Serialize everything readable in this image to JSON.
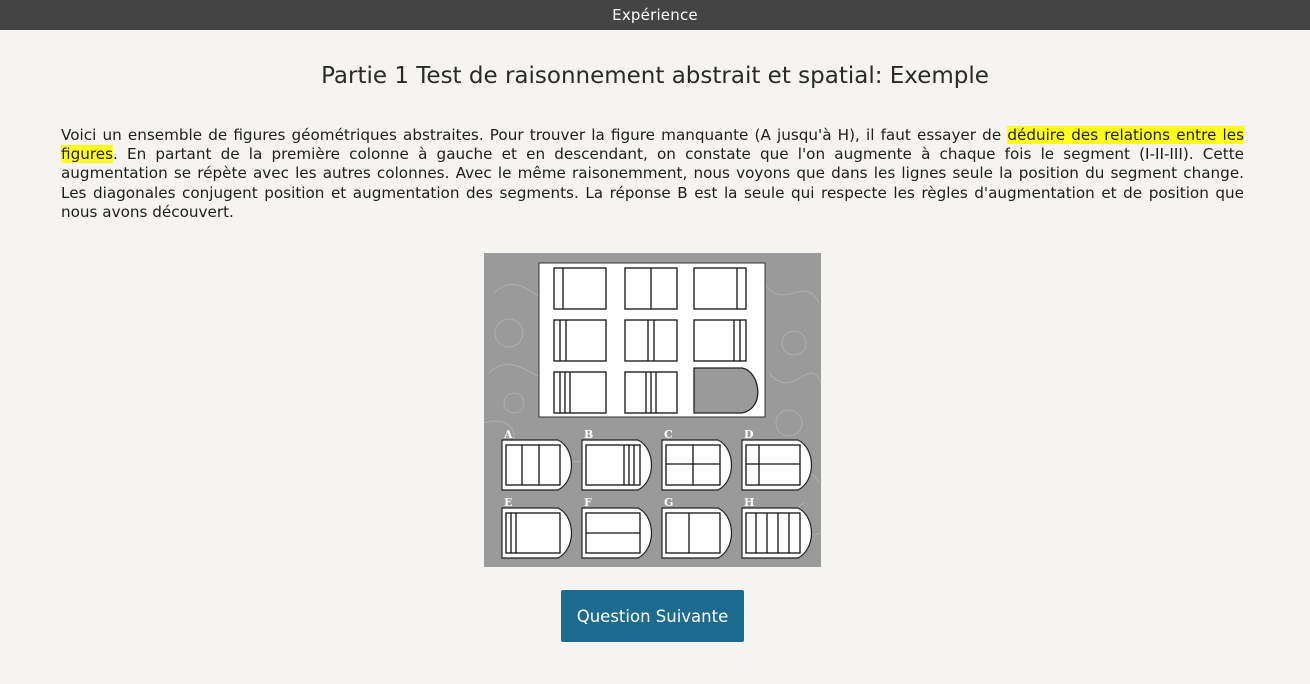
{
  "header": {
    "title": "Expérience"
  },
  "page": {
    "title": "Partie 1 Test de raisonnement abstrait et spatial: Exemple"
  },
  "instructions": {
    "before_highlight": "Voici un ensemble de figures géométriques abstraites. Pour trouver la figure manquante (A jusqu'à H), il faut essayer de ",
    "highlight": "déduire des relations entre les figures",
    "after_highlight": ". En partant de la première colonne à gauche et en descendant, on constate que l'on augmente à chaque fois le segment (I-II-III). Cette augmentation se répète avec les autres colonnes. Avec le même raisonemment, nous voyons que dans les lignes seule la position du segment change. Les diagonales conjugent position et augmentation des segments. La réponse B est la seule qui respecte les règles d'augmentation et de position que nous avons découvert.",
    "highlight_color": "#ffff1f"
  },
  "puzzle": {
    "options": [
      "A",
      "B",
      "C",
      "D",
      "E",
      "F",
      "G",
      "H"
    ]
  },
  "next_button": {
    "label": "Question Suivante"
  },
  "colors": {
    "topbar": "#444444",
    "background": "#f5f4f0",
    "button": "#1d6b8f",
    "puzzle_background": "#9a9a9a"
  }
}
